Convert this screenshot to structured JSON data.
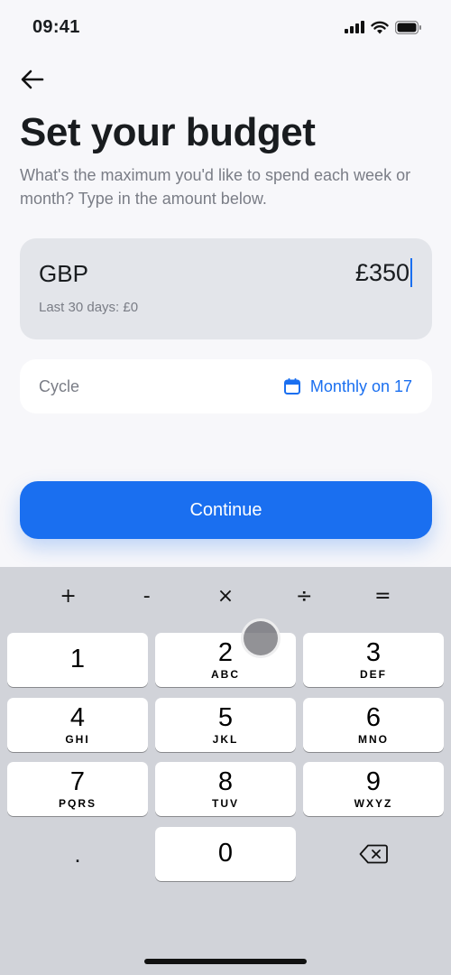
{
  "status": {
    "time": "09:41"
  },
  "header": {
    "title": "Set your budget",
    "subtitle": "What's the maximum you'd like to spend each week or month? Type in the amount below."
  },
  "amount": {
    "currency": "GBP",
    "value": "£350",
    "last_30_days": "Last 30 days: £0"
  },
  "cycle": {
    "label": "Cycle",
    "value": "Monthly on 17"
  },
  "continue_label": "Continue",
  "keyboard": {
    "operators": [
      "+",
      "-",
      "×",
      "÷",
      "="
    ],
    "keys": [
      {
        "digit": "1",
        "letters": ""
      },
      {
        "digit": "2",
        "letters": "ABC"
      },
      {
        "digit": "3",
        "letters": "DEF"
      },
      {
        "digit": "4",
        "letters": "GHI"
      },
      {
        "digit": "5",
        "letters": "JKL"
      },
      {
        "digit": "6",
        "letters": "MNO"
      },
      {
        "digit": "7",
        "letters": "PQRS"
      },
      {
        "digit": "8",
        "letters": "TUV"
      },
      {
        "digit": "9",
        "letters": "WXYZ"
      },
      {
        "digit": "0",
        "letters": ""
      }
    ],
    "decimal": "."
  },
  "colors": {
    "accent": "#1a6ff0",
    "background": "#f7f7fa",
    "card": "#e3e5ea",
    "keyboard": "#d1d3d9"
  }
}
